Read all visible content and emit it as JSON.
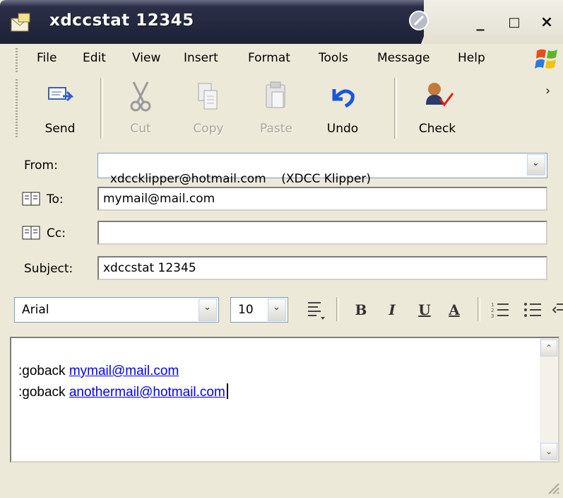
{
  "window": {
    "title": "xdccstat 12345"
  },
  "window_controls": {
    "minimize": "_",
    "maximize": "□",
    "close": "×"
  },
  "menu": [
    "File",
    "Edit",
    "View",
    "Insert",
    "Format",
    "Tools",
    "Message",
    "Help"
  ],
  "toolbar": {
    "send": "Send",
    "cut": "Cut",
    "copy": "Copy",
    "paste": "Paste",
    "undo": "Undo",
    "check": "Check",
    "more": "›"
  },
  "header": {
    "from_label": "From:",
    "from_value": "xdccklipper@hotmail.com    (XDCC Klipper)",
    "to_label": "To:",
    "to_value": "mymail@mail.com",
    "cc_label": "Cc:",
    "cc_value": "",
    "subject_label": "Subject:",
    "subject_value": "xdccstat 12345"
  },
  "format_bar": {
    "font": "Arial",
    "size": "10",
    "bold": "B",
    "italic": "I",
    "underline": "U",
    "font_color": "A"
  },
  "body": {
    "line1_prefix": ":goback ",
    "line1_link": "mymail@mail.com",
    "line2_prefix": ":goback ",
    "line2_link": "anothermail@hotmail.com"
  },
  "colors": {
    "title_bar": "#0a246a",
    "link": "#0000ff",
    "chrome": "#ece9d8"
  }
}
